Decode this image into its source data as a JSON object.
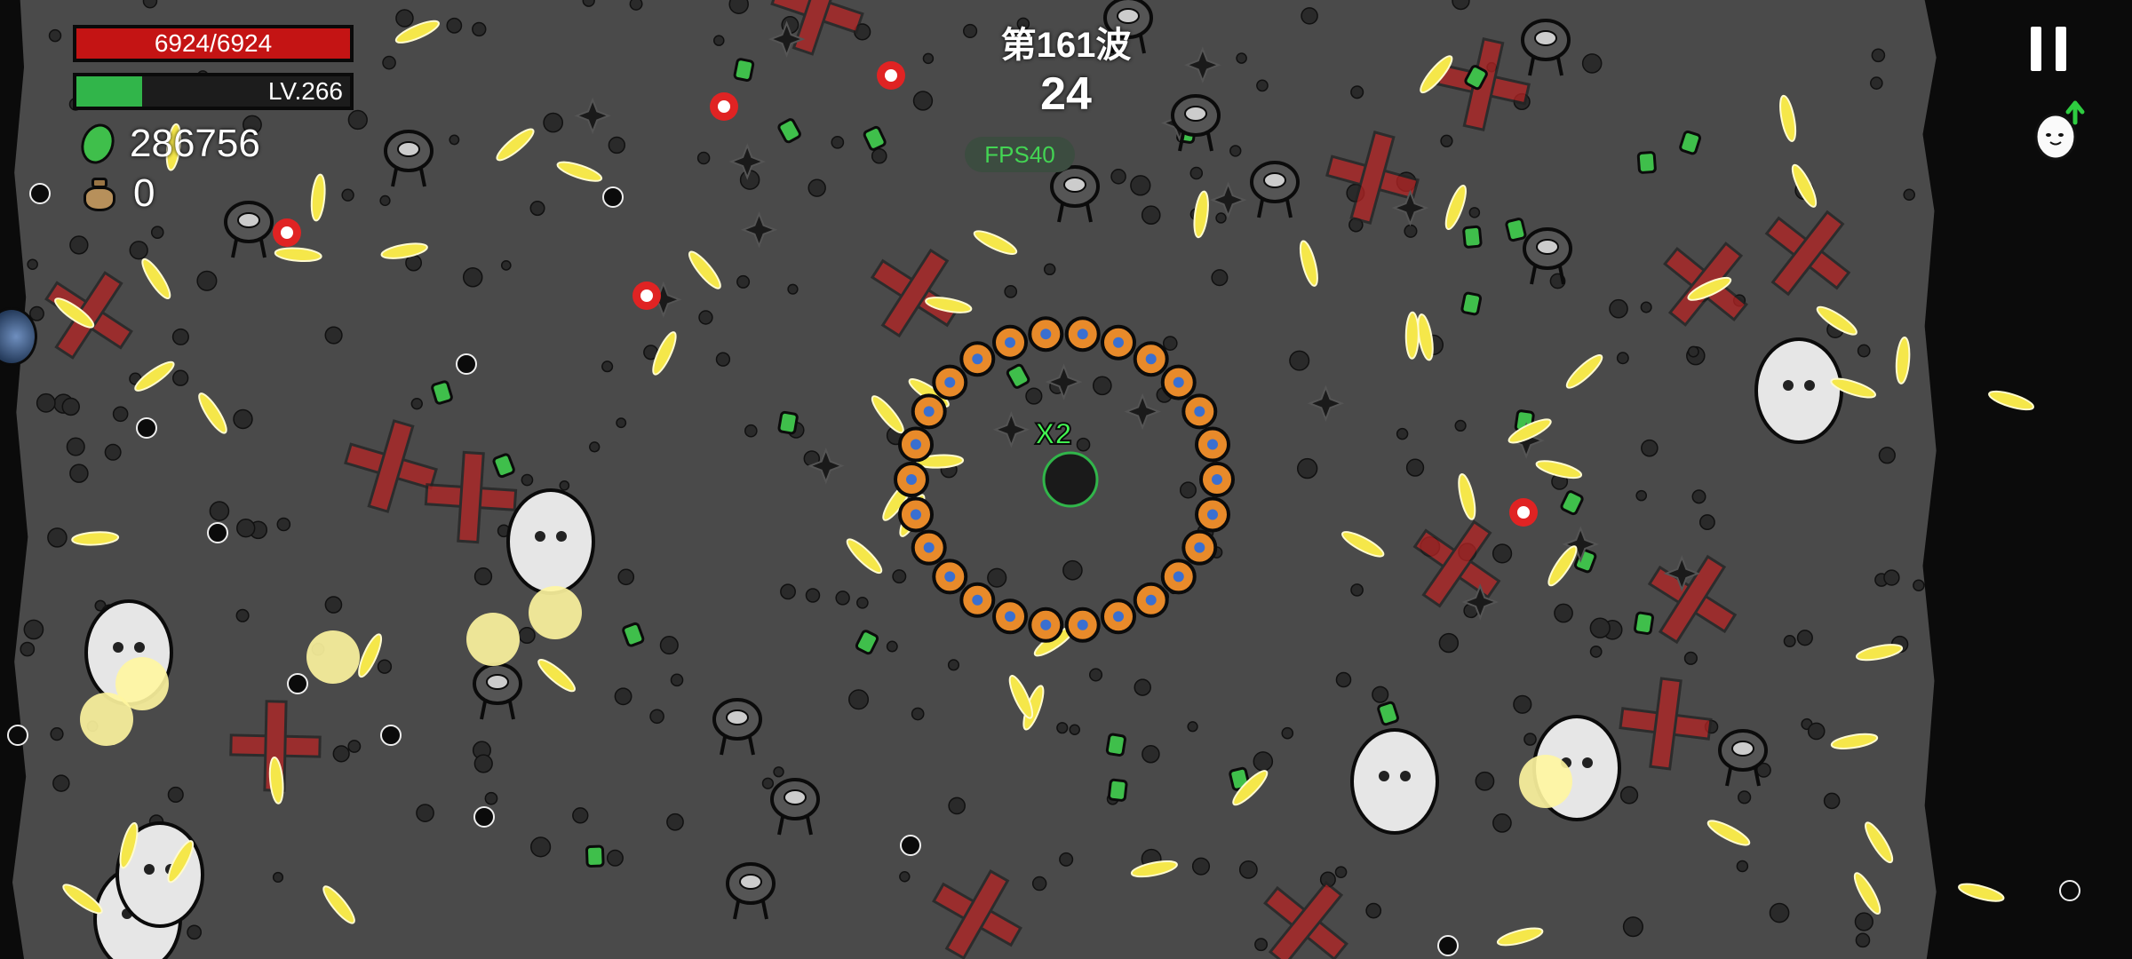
{
  "hud": {
    "hp_text": "6924/6924",
    "level_text": "LV.266",
    "xp_progress": 0.24,
    "gems_count": "286756",
    "bags_count": "0",
    "wave_title": "第161波",
    "countdown": "24",
    "fps_text": "FPS40",
    "combo_text": "X2"
  },
  "icons": {
    "gem": "green-gem-icon",
    "bag": "money-bag-icon",
    "pause": "pause-icon",
    "egg": "egg-companion-icon",
    "orb": "side-orb-icon"
  },
  "colors": {
    "arena": "#4a4a4a",
    "hp": "#c41414",
    "xp": "#31b54a",
    "fps_text": "#43d453",
    "bullet": "#f5e74a",
    "enemy_red": "#b52424",
    "gem_green": "#3fbf4b"
  }
}
